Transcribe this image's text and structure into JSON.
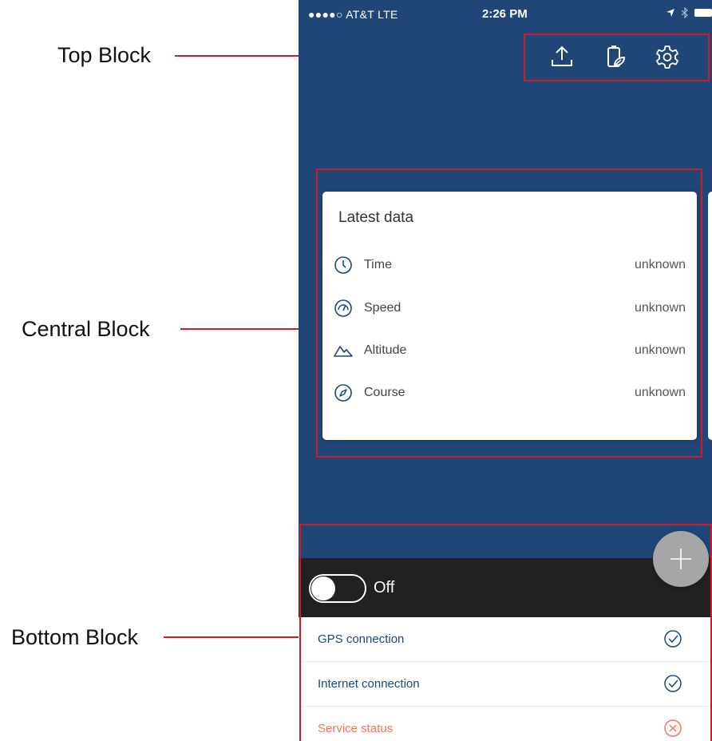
{
  "annotations": {
    "top_block": "Top Block",
    "central_block": "Central Block",
    "bottom_block": "Bottom Block"
  },
  "status_bar": {
    "carrier": "●●●●○ AT&T  LTE",
    "time": "2:26 PM"
  },
  "top_toolbar": {
    "icons": [
      "upload-icon",
      "battery-leaf-icon",
      "gear-icon"
    ]
  },
  "card": {
    "title": "Latest data",
    "rows": [
      {
        "label": "Time",
        "value": "unknown",
        "icon": "clock-icon"
      },
      {
        "label": "Speed",
        "value": "unknown",
        "icon": "speedometer-icon"
      },
      {
        "label": "Altitude",
        "value": "unknown",
        "icon": "mountain-icon"
      },
      {
        "label": "Course",
        "value": "unknown",
        "icon": "compass-icon"
      }
    ]
  },
  "tracking_toggle": {
    "state_label": "Off"
  },
  "status_list": [
    {
      "label": "GPS connection",
      "status": "ok",
      "icon": "check-circle-icon"
    },
    {
      "label": "Internet connection",
      "status": "ok",
      "icon": "check-circle-icon"
    },
    {
      "label": "Service status",
      "status": "error",
      "icon": "x-circle-icon"
    }
  ],
  "colors": {
    "background_blue": "#1f4677",
    "ok_text": "#1f4677",
    "error_text": "#f0745f",
    "annotation_red": "#c81e2a"
  }
}
